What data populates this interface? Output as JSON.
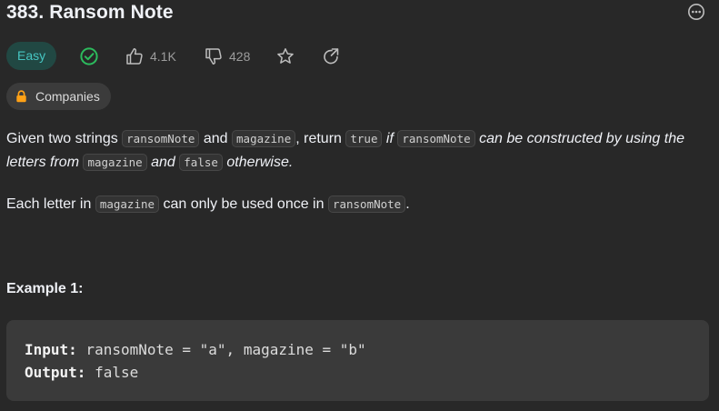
{
  "problem": {
    "title": "383. Ransom Note",
    "difficulty": "Easy",
    "likes": "4.1K",
    "dislikes": "428",
    "companies_label": "Companies"
  },
  "description": {
    "p1": {
      "t1": "Given two strings ",
      "c1": "ransomNote",
      "t2": " and ",
      "c2": "magazine",
      "t3": ", return ",
      "c3": "true",
      "t4": " if ",
      "c4": "ransomNote",
      "t5": " can be constructed by using the letters from ",
      "c5": "magazine",
      "t6": " and ",
      "c6": "false",
      "t7": " otherwise."
    },
    "p2": {
      "t1": "Each letter in ",
      "c1": "magazine",
      "t2": " can only be used once in ",
      "c2": "ransomNote",
      "t3": "."
    }
  },
  "example1": {
    "heading": "Example 1:",
    "input_label": "Input:",
    "input_value": " ransomNote = \"a\", magazine = \"b\"",
    "output_label": "Output:",
    "output_value": " false"
  },
  "colors": {
    "background": "#282828",
    "easy_bg": "#214843",
    "easy_text": "#46c6c2",
    "solved_green": "#2cbb5d",
    "lock_orange": "#ffa116"
  },
  "icons": [
    "more-icon",
    "solved-check-icon",
    "thumbs-up-icon",
    "thumbs-down-icon",
    "star-icon",
    "share-icon",
    "lock-icon"
  ]
}
